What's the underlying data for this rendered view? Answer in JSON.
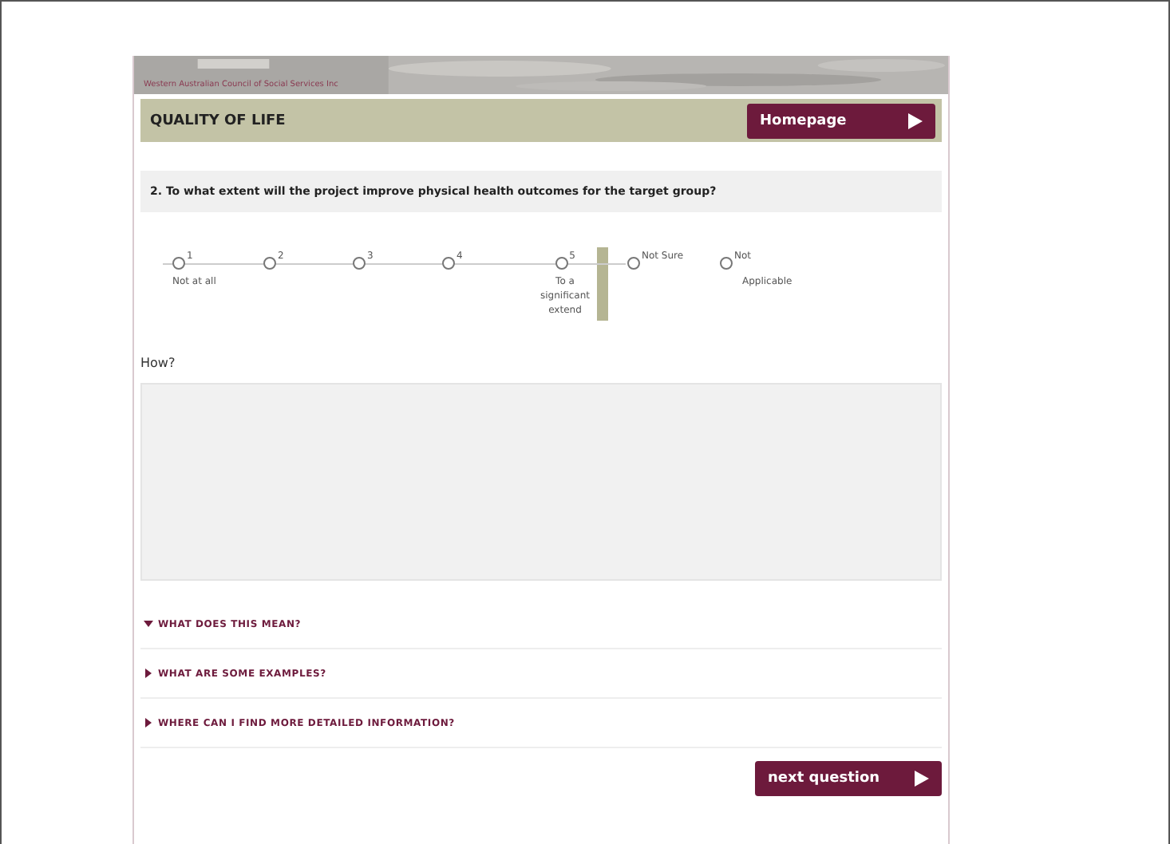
{
  "banner": {
    "kind": "picture",
    "subtitle": "Western Australian Council of Social Services Inc"
  },
  "section": {
    "title": "QUALITY OF LIFE",
    "button": "Homepage"
  },
  "question": "2. To what extent will the project improve physical health outcomes for the target group?",
  "scale": [
    {
      "label": "1",
      "caption": "Not at all",
      "selected": false
    },
    {
      "label": "2",
      "selected": false
    },
    {
      "label": "3",
      "selected": false
    },
    {
      "label": "4",
      "selected": false
    },
    {
      "label": "5",
      "caption": "To a significant extend",
      "selected": false
    }
  ],
  "extra_options": [
    {
      "label": "Not Sure",
      "selected": false
    },
    {
      "label": "Not",
      "caption": "Applicable",
      "selected": false
    }
  ],
  "how": {
    "label": "How?"
  },
  "accordion": [
    {
      "title": "WHAT DOES THIS MEAN?",
      "expanded": true
    },
    {
      "title": "WHAT ARE SOME EXAMPLES?",
      "expanded": false
    },
    {
      "title": "WHERE CAN I FIND MORE DETAILED INFORMATION?",
      "expanded": false
    }
  ],
  "next_button": "next question"
}
